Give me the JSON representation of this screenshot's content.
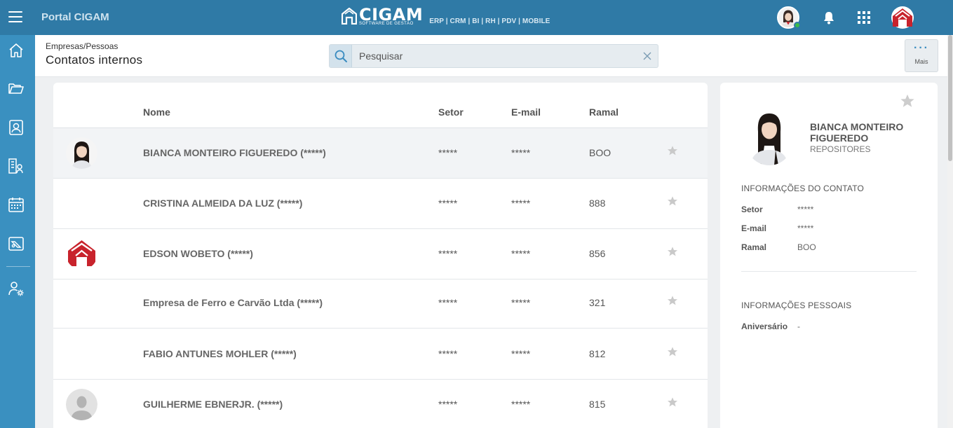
{
  "topbar": {
    "portal_title": "Portal CIGAM",
    "brand_name": "CIGAM",
    "brand_tagline": "SOFTWARE DE GESTÃO",
    "brand_modules": "ERP | CRM | BI | RH | PDV | MOBILE"
  },
  "sidebar": {
    "items": [
      {
        "icon": "home-icon"
      },
      {
        "icon": "folder-icon"
      },
      {
        "icon": "contact-card-icon"
      },
      {
        "icon": "org-chart-icon"
      },
      {
        "icon": "calendar-icon"
      },
      {
        "icon": "ticket-icon"
      },
      {
        "icon": "user-settings-icon"
      }
    ]
  },
  "header": {
    "breadcrumb": "Empresas/Pessoas",
    "title": "Contatos internos",
    "search_placeholder": "Pesquisar",
    "more_label": "Mais",
    "more_dots": "···"
  },
  "table": {
    "columns": {
      "name": "Nome",
      "sector": "Setor",
      "email": "E-mail",
      "extension": "Ramal"
    },
    "rows": [
      {
        "name": "BIANCA MONTEIRO FIGUEREDO (*****)",
        "sector": "*****",
        "email": "*****",
        "extension": "BOO",
        "avatar": "woman",
        "selected": true
      },
      {
        "name": "CRISTINA ALMEIDA DA LUZ (*****)",
        "sector": "*****",
        "email": "*****",
        "extension": "888",
        "avatar": "none",
        "selected": false
      },
      {
        "name": "EDSON WOBETO (*****)",
        "sector": "*****",
        "email": "*****",
        "extension": "856",
        "avatar": "logo",
        "selected": false
      },
      {
        "name": "Empresa de Ferro e Carvão Ltda (*****)",
        "sector": "*****",
        "email": "*****",
        "extension": "321",
        "avatar": "none",
        "selected": false
      },
      {
        "name": "FABIO ANTUNES MOHLER (*****)",
        "sector": "*****",
        "email": "*****",
        "extension": "812",
        "avatar": "none",
        "selected": false
      },
      {
        "name": "GUILHERME EBNERJR. (*****)",
        "sector": "*****",
        "email": "*****",
        "extension": "815",
        "avatar": "silhouette",
        "selected": false
      }
    ]
  },
  "detail": {
    "name": "BIANCA MONTEIRO FIGUEREDO",
    "role": "REPOSITORES",
    "contact_section": "INFORMAÇÕES DO CONTATO",
    "contact": [
      {
        "key": "Setor",
        "value": "*****"
      },
      {
        "key": "E-mail",
        "value": "*****"
      },
      {
        "key": "Ramal",
        "value": "BOO"
      }
    ],
    "personal_section": "INFORMAÇÕES PESSOAIS",
    "personal": [
      {
        "key": "Aniversário",
        "value": "-"
      }
    ]
  },
  "colors": {
    "topbar": "#2f7aa6",
    "sidebar": "#3a90c0",
    "brand_red": "#c8232c",
    "online": "#3cbb47"
  }
}
